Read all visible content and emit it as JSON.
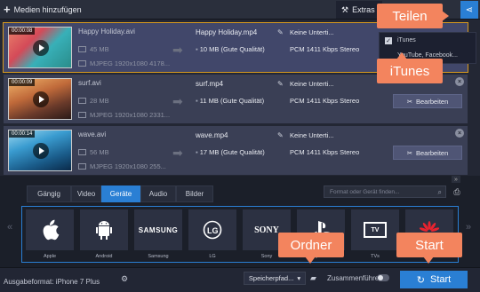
{
  "toolbar": {
    "add_label": "Medien hinzufügen",
    "extras_label": "Extras"
  },
  "files": [
    {
      "duration": "00:00:08",
      "name": "Happy Holiday.avi",
      "size": "45 MB",
      "codec": "MJPEG 1920x1080 4178...",
      "output_name": "Happy Holiday.mp4",
      "output_size": "10 MB (Gute Qualität)",
      "audio": "PCM 1411 Kbps Stereo",
      "subtitles": "Keine Unterti..."
    },
    {
      "duration": "00:00:09",
      "name": "surf.avi",
      "size": "28 MB",
      "codec": "MJPEG 1920x1080 2331...",
      "output_name": "surf.mp4",
      "output_size": "11 MB (Gute Qualität)",
      "audio": "PCM 1411 Kbps Stereo",
      "subtitles": "Keine Unterti...",
      "edit_label": "Bearbeiten"
    },
    {
      "duration": "00:00:14",
      "name": "wave.avi",
      "size": "56 MB",
      "codec": "MJPEG 1920x1080 255...",
      "output_name": "wave.mp4",
      "output_size": "17 MB (Gute Qualität)",
      "audio": "PCM 1411 Kbps Stereo",
      "subtitles": "Keine Unterti...",
      "edit_label": "Bearbeiten"
    }
  ],
  "share_menu": {
    "items": [
      "iTunes",
      "YouTube, Facebook..."
    ]
  },
  "tabs": [
    "Gängig",
    "Video",
    "Geräte",
    "Audio",
    "Bilder"
  ],
  "search": {
    "placeholder": "Format oder Gerät finden..."
  },
  "devices": [
    {
      "label": "Apple",
      "logo": ""
    },
    {
      "label": "Android",
      "logo": ""
    },
    {
      "label": "Samsung",
      "logo": "SAMSUNG"
    },
    {
      "label": "LG",
      "logo": ""
    },
    {
      "label": "Sony",
      "logo": "SONY"
    },
    {
      "label": "PlayStation",
      "logo": ""
    },
    {
      "label": "TVs",
      "logo": "TV"
    },
    {
      "label": "Huawei",
      "logo": ""
    }
  ],
  "bottom": {
    "output_format": "Ausgabeformat: iPhone 7 Plus",
    "save_label": "Speicherpfad...",
    "merge_label": "Zusammenführen",
    "start_label": "Start"
  },
  "callouts": {
    "share": "Teilen",
    "itunes": "iTunes",
    "folder": "Ordner",
    "start": "Start"
  },
  "colors": {
    "accent": "#2a7fd4",
    "callout": "#f3845e",
    "selection": "#d89a1e"
  }
}
